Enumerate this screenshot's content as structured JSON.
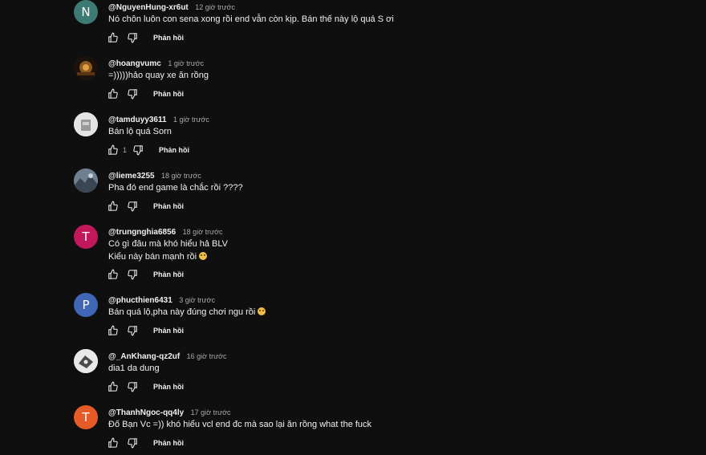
{
  "icons": {
    "like": "thumbs-up-icon",
    "dislike": "thumbs-down-icon"
  },
  "colors": {
    "background": "#0f0f0f",
    "avatar_n": "#3d7a73",
    "avatar_t": "#c2185b",
    "avatar_p": "#3f67b5",
    "avatar_t2": "#e65b28"
  },
  "comments": [
    {
      "author": "@NguyenHung-xr6ut",
      "time": "12 giờ trước",
      "lines": [
        "Nó chôn luôn con sena xong rồi end vẫn còn kịp. Bán thế này lộ quá S ơi"
      ],
      "avatar_letter": "N",
      "like_count": "",
      "reply_label": "Phản hồi"
    },
    {
      "author": "@hoangvumc",
      "time": "1 giờ trước",
      "lines": [
        "=)))))hảo quay xe ăn rồng"
      ],
      "avatar_letter": "",
      "like_count": "",
      "reply_label": "Phản hồi"
    },
    {
      "author": "@tamduyy3611",
      "time": "1 giờ trước",
      "lines": [
        "Bán lộ quá Sorn"
      ],
      "avatar_letter": "",
      "like_count": "1",
      "reply_label": "Phản hồi"
    },
    {
      "author": "@lieme3255",
      "time": "18 giờ trước",
      "lines": [
        "Pha đó end game là chắc rồi ????"
      ],
      "avatar_letter": "",
      "like_count": "",
      "reply_label": "Phản hồi"
    },
    {
      "author": "@trungnghia6856",
      "time": "18 giờ trước",
      "lines": [
        "Có gì đâu mà khó hiểu hả BLV",
        "Kiểu này bán mạnh rồi"
      ],
      "avatar_letter": "T",
      "like_count": "",
      "reply_label": "Phản hồi"
    },
    {
      "author": "@phucthien6431",
      "time": "3 giờ trước",
      "lines": [
        "Bán quá lộ,pha này đúng chơi ngu rồi"
      ],
      "avatar_letter": "P",
      "like_count": "",
      "reply_label": "Phản hồi"
    },
    {
      "author": "@_AnKhang-qz2uf",
      "time": "16 giờ trước",
      "lines": [
        "dia1 da dung"
      ],
      "avatar_letter": "",
      "like_count": "",
      "reply_label": "Phản hồi"
    },
    {
      "author": "@ThanhNgoc-qq4ly",
      "time": "17 giờ trước",
      "lines": [
        "Đố Bạn Vc =)) khó hiểu vcl end đc mà sao lại ăn rồng what the fuck"
      ],
      "avatar_letter": "T",
      "like_count": "",
      "reply_label": "Phản hồi"
    }
  ]
}
